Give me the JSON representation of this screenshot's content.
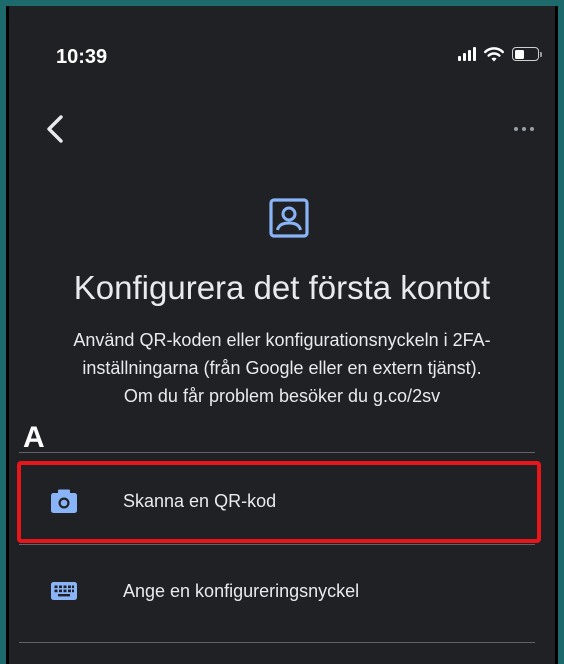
{
  "status_bar": {
    "time": "10:39",
    "icons": [
      "signal-icon",
      "wifi-icon",
      "battery-icon"
    ]
  },
  "nav": {
    "back_icon": "chevron-left-icon",
    "more_icon": "more-horizontal-icon"
  },
  "main": {
    "hero_icon": "account-box-icon",
    "title": "Konfigurera det första kontot",
    "description_lines": [
      "Använd QR-koden eller konfigurationsnyckeln i 2FA-",
      "inställningarna (från Google eller en extern tjänst).",
      "Om du får problem besöker du g.co/2sv"
    ]
  },
  "annotation": {
    "label": "A",
    "color": "#e8151b"
  },
  "options": [
    {
      "icon": "camera-icon",
      "label": "Skanna en QR-kod"
    },
    {
      "icon": "keyboard-icon",
      "label": "Ange en konfigureringsnyckel"
    }
  ],
  "colors": {
    "background": "#202124",
    "accent_blue": "#8ab4f8",
    "text": "#e8eaed",
    "divider": "#5f6368"
  }
}
